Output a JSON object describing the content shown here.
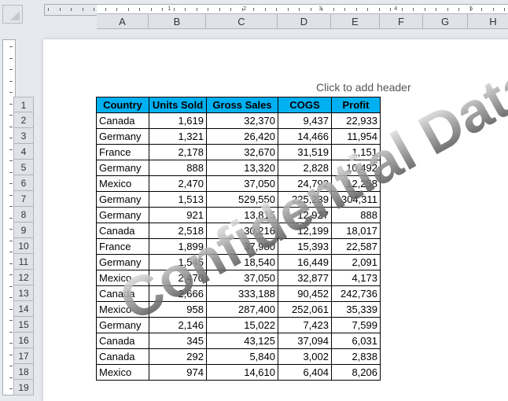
{
  "ruler": {
    "marks": [
      "1",
      "2",
      "3",
      "4",
      "5"
    ]
  },
  "columns": [
    "A",
    "B",
    "C",
    "D",
    "E",
    "F",
    "G",
    "H"
  ],
  "rows": [
    "1",
    "2",
    "3",
    "4",
    "5",
    "6",
    "7",
    "8",
    "9",
    "10",
    "11",
    "12",
    "13",
    "14",
    "15",
    "16",
    "17",
    "18",
    "19"
  ],
  "header_hint": "Click to add header",
  "table": {
    "headers": [
      "Country",
      "Units Sold",
      "Gross Sales",
      "COGS",
      "Profit"
    ],
    "rows": [
      [
        "Canada",
        "1,619",
        "32,370",
        "9,437",
        "22,933"
      ],
      [
        "Germany",
        "1,321",
        "26,420",
        "14,466",
        "11,954"
      ],
      [
        "France",
        "2,178",
        "32,670",
        "31,519",
        "1,151"
      ],
      [
        "Germany",
        "888",
        "13,320",
        "2,828",
        "10,492"
      ],
      [
        "Mexico",
        "2,470",
        "37,050",
        "24,792",
        "12,258"
      ],
      [
        "Germany",
        "1,513",
        "529,550",
        "225,239",
        "304,311"
      ],
      [
        "Germany",
        "921",
        "13,815",
        "12,927",
        "888"
      ],
      [
        "Canada",
        "2,518",
        "30,216",
        "12,199",
        "18,017"
      ],
      [
        "France",
        "1,899",
        "37,980",
        "15,393",
        "22,587"
      ],
      [
        "Germany",
        "1,545",
        "18,540",
        "16,449",
        "2,091"
      ],
      [
        "Mexico",
        "2,470",
        "37,050",
        "32,877",
        "4,173"
      ],
      [
        "Canada",
        "2,666",
        "333,188",
        "90,452",
        "242,736"
      ],
      [
        "Mexico",
        "958",
        "287,400",
        "252,061",
        "35,339"
      ],
      [
        "Germany",
        "2,146",
        "15,022",
        "7,423",
        "7,599"
      ],
      [
        "Canada",
        "345",
        "43,125",
        "37,094",
        "6,031"
      ],
      [
        "Canada",
        "292",
        "5,840",
        "3,002",
        "2,838"
      ],
      [
        "Mexico",
        "974",
        "14,610",
        "6,404",
        "8,206"
      ]
    ]
  },
  "watermark": "Confidential Data",
  "colors": {
    "header_fill": "#00B0F0"
  }
}
